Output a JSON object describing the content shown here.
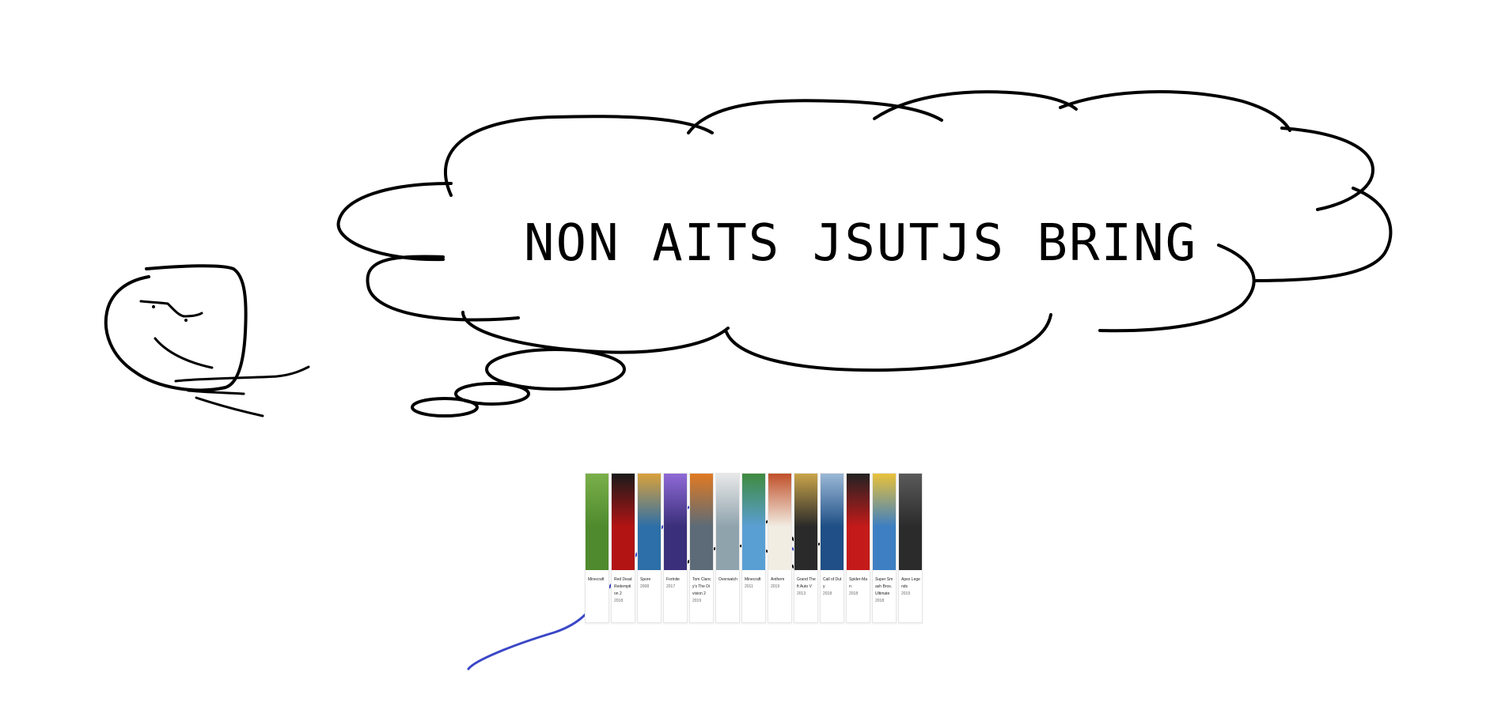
{
  "thought_bubble": {
    "text": "NON AITS JSUTJS BRING"
  },
  "colors": {
    "ink": "#000000",
    "blue_ink": "#3b47c7",
    "background": "#ffffff"
  },
  "game_cards": [
    {
      "title": "Minecraft",
      "year": "",
      "cover_color": "#4f8a2e",
      "cover_accent": "#7ab04a",
      "icon": "minecraft-cover"
    },
    {
      "title": "Red Dead Redemption 2",
      "year": "2018",
      "cover_color": "#b21414",
      "cover_accent": "#1a1a1a",
      "icon": "red-dead-cover"
    },
    {
      "title": "Spore",
      "year": "2008",
      "cover_color": "#2d6fa8",
      "cover_accent": "#d9a13b",
      "icon": "spore-cover"
    },
    {
      "title": "Fortnite",
      "year": "2017",
      "cover_color": "#3a2f7a",
      "cover_accent": "#8f6ad6",
      "icon": "fortnite-cover"
    },
    {
      "title": "Tom Clancy's The Division 2",
      "year": "2019",
      "cover_color": "#5c6b77",
      "cover_accent": "#e07a22",
      "icon": "division-cover"
    },
    {
      "title": "Overwatch",
      "year": "",
      "cover_color": "#8fa3ad",
      "cover_accent": "#e8e8e8",
      "icon": "overwatch-cover"
    },
    {
      "title": "Minecraft",
      "year": "2011",
      "cover_color": "#5a9fd4",
      "cover_accent": "#3f8a3f",
      "icon": "minecraft-story-cover"
    },
    {
      "title": "Anthem",
      "year": "2019",
      "cover_color": "#f2ede3",
      "cover_accent": "#c0502a",
      "icon": "anthem-cover"
    },
    {
      "title": "Grand Theft Auto V",
      "year": "2013",
      "cover_color": "#2a2a2a",
      "cover_accent": "#c9a44a",
      "icon": "gta-cover"
    },
    {
      "title": "Call of Duty",
      "year": "2018",
      "cover_color": "#1f4f86",
      "cover_accent": "#9bb8d6",
      "icon": "cod-cover"
    },
    {
      "title": "Spider-Man",
      "year": "2018",
      "cover_color": "#c41a1a",
      "cover_accent": "#222222",
      "icon": "spiderman-cover"
    },
    {
      "title": "Super Smash Bros. Ultimate",
      "year": "2018",
      "cover_color": "#3d7fc2",
      "cover_accent": "#e9c23a",
      "icon": "smash-cover"
    },
    {
      "title": "Apex Legends",
      "year": "2019",
      "cover_color": "#2b2b2b",
      "cover_accent": "#5a5a5a",
      "icon": "apex-cover"
    }
  ]
}
